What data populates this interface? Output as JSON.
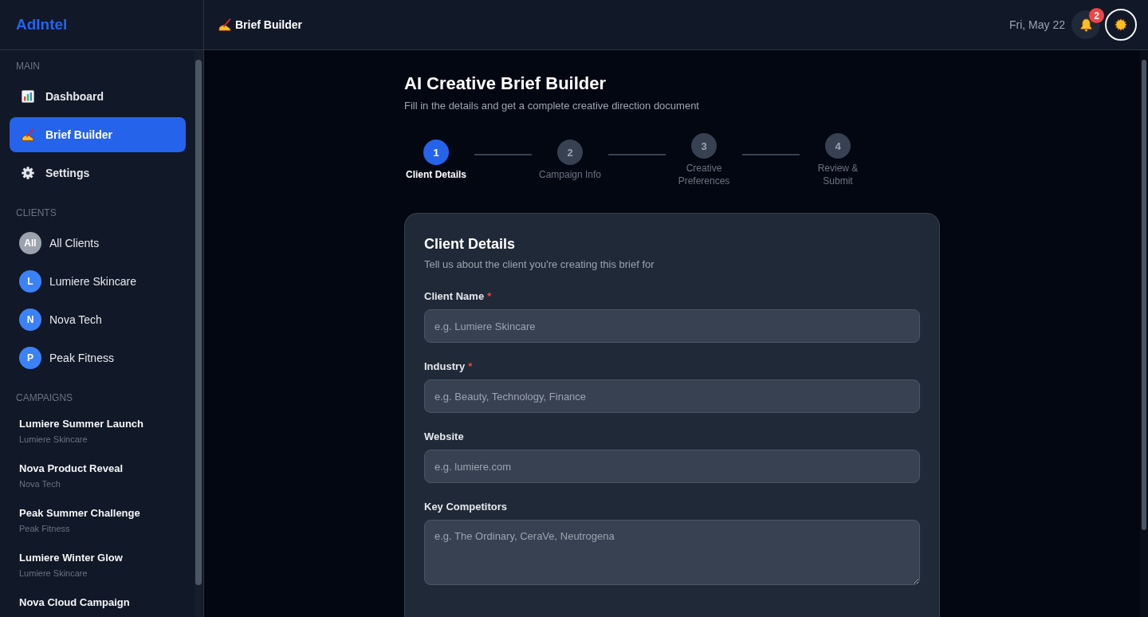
{
  "sidebar": {
    "logo": "AdIntel",
    "sections": [
      {
        "heading": "MAIN",
        "kind": "nav",
        "items": [
          {
            "label": "Dashboard",
            "selected": false
          },
          {
            "label": "Brief Builder",
            "selected": true
          },
          {
            "label": "Settings",
            "selected": false
          }
        ]
      },
      {
        "heading": "CLIENTS",
        "kind": "clients",
        "items": [
          {
            "initial": "All",
            "label": "All Clients",
            "color": "#9ca3af",
            "selected": false
          },
          {
            "initial": "L",
            "label": "Lumiere Skincare",
            "color": "#3b82f6",
            "selected": false
          },
          {
            "initial": "N",
            "label": "Nova Tech",
            "color": "#3b82f6",
            "selected": false
          },
          {
            "initial": "P",
            "label": "Peak Fitness",
            "color": "#3b82f6",
            "selected": false
          }
        ]
      },
      {
        "heading": "CAMPAIGNS",
        "kind": "campaigns",
        "items": [
          {
            "name": "Lumiere Summer Launch",
            "client": "Lumiere Skincare",
            "selected": false
          },
          {
            "name": "Nova Product Reveal",
            "client": "Nova Tech",
            "selected": false
          },
          {
            "name": "Peak Summer Challenge",
            "client": "Peak Fitness",
            "selected": false
          },
          {
            "name": "Lumiere Winter Glow",
            "client": "Lumiere Skincare",
            "selected": false
          },
          {
            "name": "Nova Cloud Campaign",
            "selected": false
          }
        ]
      }
    ]
  },
  "top_bar": {
    "title": "Brief Builder",
    "date": "Fri, May 22",
    "notification_count": "2"
  },
  "page": {
    "title": "AI Creative Brief Builder",
    "subtitle": "Fill in the details and get a complete creative direction document"
  },
  "steps": [
    {
      "number": "1",
      "label": "Client Details",
      "selected": true
    },
    {
      "number": "2",
      "label": "Campaign Info",
      "selected": false
    },
    {
      "number": "3",
      "label": "Creative Preferences",
      "selected": false
    },
    {
      "number": "4",
      "label": "Review & Submit",
      "selected": false
    }
  ],
  "form": {
    "title": "Client Details",
    "description": "Tell us about the client you're creating this brief for",
    "fields": [
      {
        "kind": "input",
        "label": "Client Name",
        "required_mark": "*",
        "placeholder": "e.g. Lumiere Skincare"
      },
      {
        "kind": "input",
        "label": "Industry",
        "required_mark": "*",
        "placeholder": "e.g. Beauty, Technology, Finance"
      },
      {
        "kind": "input",
        "label": "Website",
        "placeholder": "e.g. lumiere.com"
      },
      {
        "kind": "textarea",
        "label": "Key Competitors",
        "placeholder": "e.g. The Ordinary, CeraVe, Neutrogena"
      }
    ]
  }
}
